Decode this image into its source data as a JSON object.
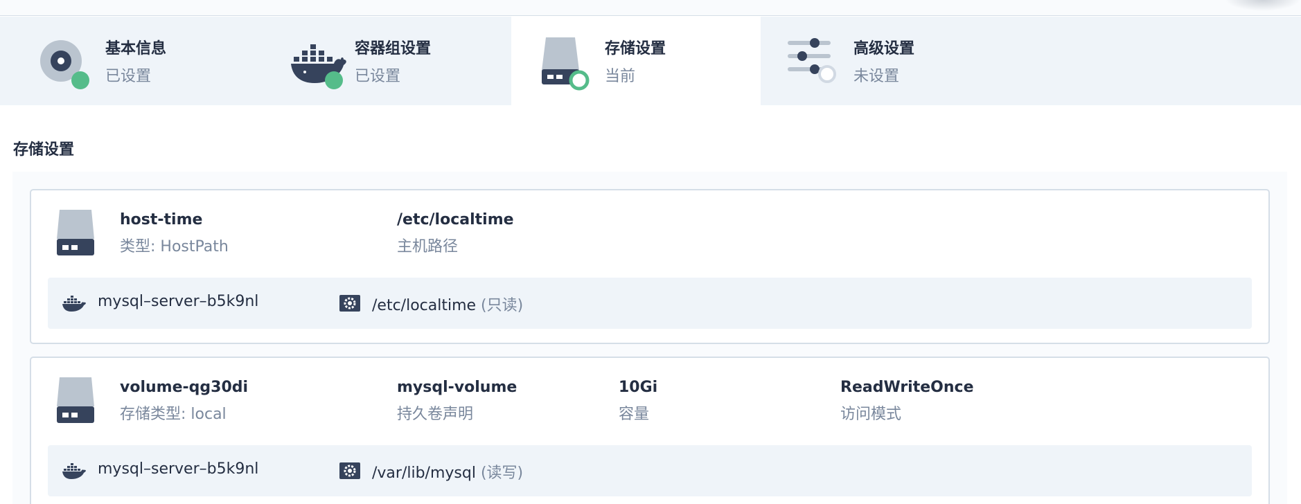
{
  "steps": [
    {
      "title": "基本信息",
      "status": "已设置",
      "icon": "info-disc-icon",
      "state": "done"
    },
    {
      "title": "容器组设置",
      "status": "已设置",
      "icon": "docker-whale-icon",
      "state": "done"
    },
    {
      "title": "存储设置",
      "status": "当前",
      "icon": "storage-disk-icon",
      "state": "current"
    },
    {
      "title": "高级设置",
      "status": "未设置",
      "icon": "sliders-icon",
      "state": "pending"
    }
  ],
  "section_title": "存储设置",
  "volumes": [
    {
      "name": "host-time",
      "type_label": "类型: HostPath",
      "fields": [
        {
          "value": "/etc/localtime",
          "label": "主机路径"
        }
      ],
      "mount": {
        "container": "mysql–server–b5k9nl",
        "path": "/etc/localtime",
        "mode": "(只读)"
      }
    },
    {
      "name": "volume-qg30di",
      "type_label": "存储类型: local",
      "fields": [
        {
          "value": "mysql-volume",
          "label": "持久卷声明"
        },
        {
          "value": "10Gi",
          "label": "容量"
        },
        {
          "value": "ReadWriteOnce",
          "label": "访问模式"
        }
      ],
      "mount": {
        "container": "mysql–server–b5k9nl",
        "path": "/var/lib/mysql",
        "mode": "(读写)"
      }
    }
  ],
  "colors": {
    "done": "#55bc8a",
    "pending": "#d1d9e3",
    "text": "#242e42",
    "muted": "#79879c",
    "dark": "#36435c",
    "disk": "#bac4cf"
  }
}
